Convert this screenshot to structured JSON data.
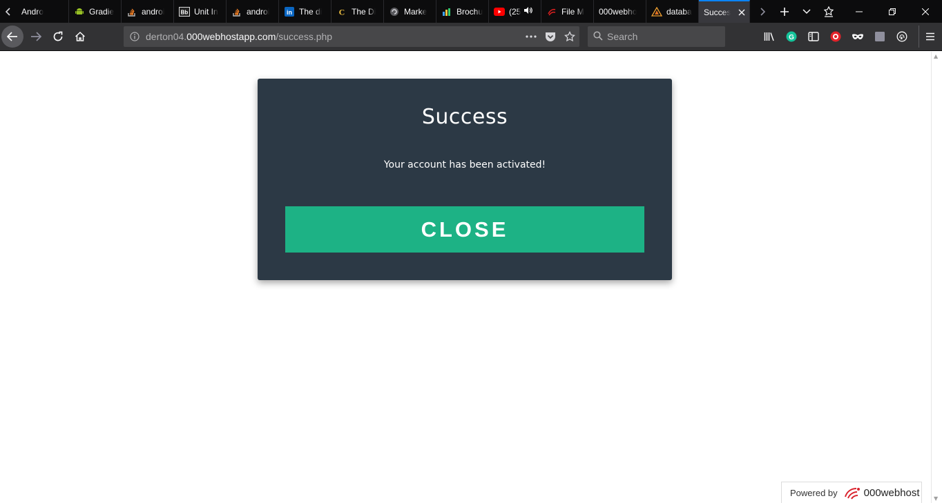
{
  "browser": {
    "tabs": [
      {
        "label": "Andro",
        "icon": "page-icon"
      },
      {
        "label": "Gradie",
        "icon": "android-icon"
      },
      {
        "label": "androi",
        "icon": "stackoverflow-icon"
      },
      {
        "label": "Unit In",
        "icon": "blackboard-icon"
      },
      {
        "label": "androi",
        "icon": "stackoverflow-icon"
      },
      {
        "label": "The di",
        "icon": "linkedin-icon"
      },
      {
        "label": "The Di",
        "icon": "codecademy-icon"
      },
      {
        "label": "Marke",
        "icon": "globe-icon"
      },
      {
        "label": "Brochu",
        "icon": "chart-icon"
      },
      {
        "label": "(25",
        "icon": "youtube-icon"
      },
      {
        "label": "File M",
        "icon": "swirl-icon"
      },
      {
        "label": "000webho",
        "icon": "none"
      },
      {
        "label": "databa",
        "icon": "triangle-icon"
      },
      {
        "label": "Succes",
        "icon": "none",
        "active": true
      }
    ],
    "url": {
      "host_prefix": "derton04.",
      "host": "000webhostapp.com",
      "path": "/success.php"
    },
    "search_placeholder": "Search"
  },
  "modal": {
    "title": "Success",
    "message": "Your account has been activated!",
    "close_label": "CLOSE"
  },
  "footer": {
    "powered_label": "Powered by",
    "brand": "000webhost"
  },
  "colors": {
    "modal_bg": "#2c3945",
    "button_bg": "#1db285",
    "tab_accent": "#0a84ff"
  }
}
